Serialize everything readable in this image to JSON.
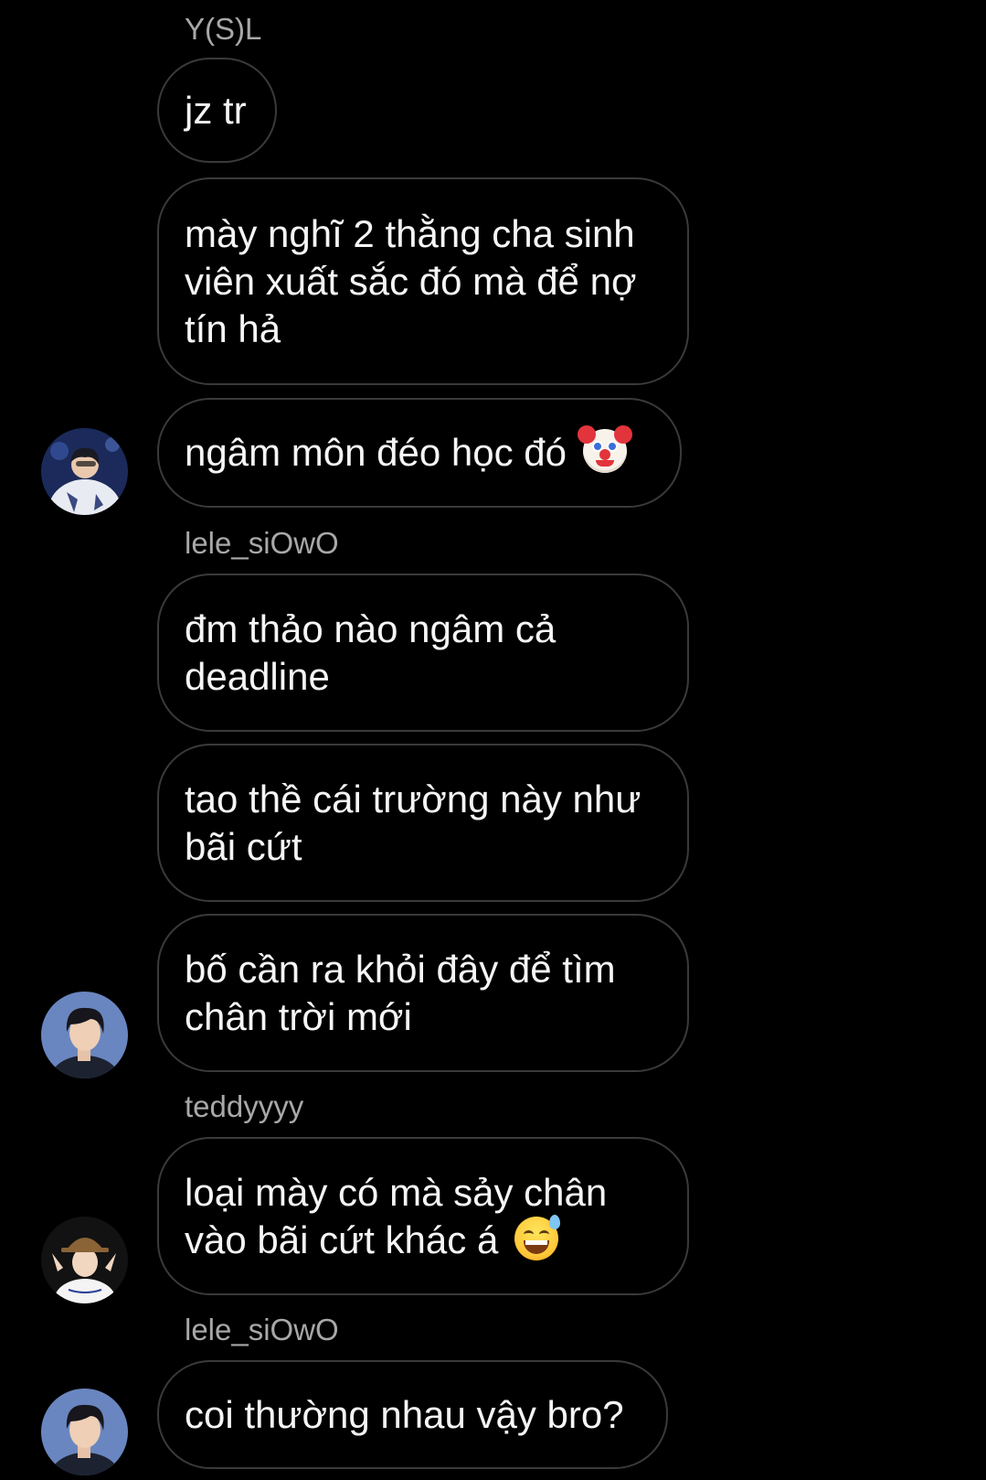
{
  "conversation": {
    "senders": {
      "first": "Y(S)L",
      "second": "lele_siOwO",
      "third": "teddyyyy",
      "fourth": "lele_siOwO"
    },
    "messages": {
      "m1": "jz tr",
      "m2_lines": [
        "mày nghĩ 2 thằng cha sinh",
        "viên xuất sắc đó mà để nợ",
        "tín hả"
      ],
      "m3": "ngâm môn đéo học đó",
      "m3_emoji": "clown-face-icon",
      "m4_lines": [
        "đm thảo nào ngâm cả",
        "deadline"
      ],
      "m5_lines": [
        "tao thề cái trường này như",
        "bãi cứt"
      ],
      "m6_lines": [
        "bố cần ra khỏi đây để tìm",
        "chân trời mới"
      ],
      "m7_lines": [
        "loại mày có mà sảy chân",
        "vào bãi cứt khác á"
      ],
      "m7_emoji": "grinning-sweat-icon",
      "m8": "coi thường nhau vậy bro?"
    }
  },
  "theme": {
    "background": "#000000",
    "bubble_border": "#3a3a3a",
    "text": "#f5f5f5",
    "sender_text": "#a8a8a8"
  }
}
